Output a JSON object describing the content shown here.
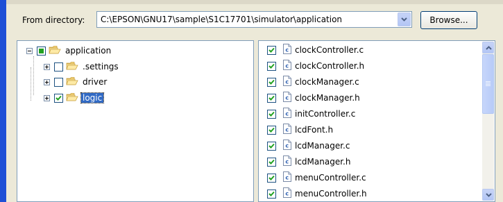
{
  "header": {
    "from_directory_label": "From directory:",
    "directory_value": "C:\\EPSON\\GNU17\\sample\\S1C17701\\simulator\\application",
    "browse_label": "Browse..."
  },
  "tree": {
    "root": {
      "label": "application",
      "state": "partial",
      "expanded": true
    },
    "children": [
      {
        "label": ".settings",
        "checked": false,
        "expanded": false,
        "selected": false
      },
      {
        "label": "driver",
        "checked": false,
        "expanded": false,
        "selected": false
      },
      {
        "label": "logic",
        "checked": true,
        "expanded": false,
        "selected": true
      }
    ]
  },
  "files": [
    {
      "name": "clockController.c",
      "checked": true
    },
    {
      "name": "clockController.h",
      "checked": true
    },
    {
      "name": "clockManager.c",
      "checked": true
    },
    {
      "name": "clockManager.h",
      "checked": true
    },
    {
      "name": "initController.c",
      "checked": true
    },
    {
      "name": "lcdFont.h",
      "checked": true
    },
    {
      "name": "lcdManager.c",
      "checked": true
    },
    {
      "name": "lcdManager.h",
      "checked": true
    },
    {
      "name": "menuController.c",
      "checked": true
    },
    {
      "name": "menuController.h",
      "checked": true
    }
  ],
  "colors": {
    "accent": "#1e4fd6",
    "selection": "#316ac5",
    "check": "#21a121"
  }
}
